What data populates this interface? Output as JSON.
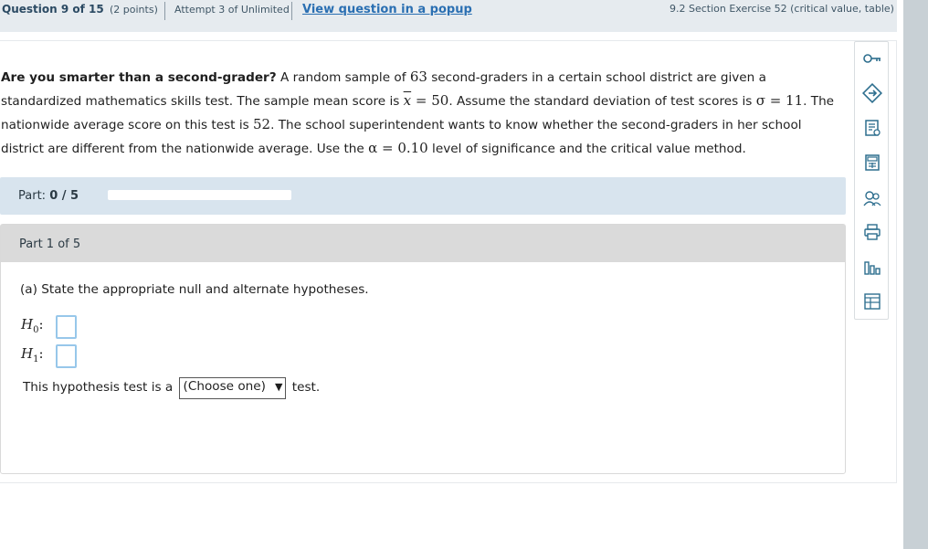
{
  "header": {
    "question_num": "Question 9 of 15",
    "points": "(2 points)",
    "attempt": "Attempt 3 of Unlimited",
    "popup_link": "View question in a popup",
    "section": "9.2 Section Exercise 52 (critical value, table)"
  },
  "question": {
    "lead_bold": "Are you smarter than a second-grader?",
    "t1": " A random sample of ",
    "n": "63",
    "t2": " second-graders in a certain school district are given a standardized mathematics skills test. The sample mean score is ",
    "xbar_sym": "x",
    "eq1": " = 50",
    "t3": ". Assume the standard deviation of test scores is ",
    "sigma": "σ = 11",
    "t4": ". The nationwide average score on this test is ",
    "mu": "52",
    "t5": ". The school superintendent wants to know whether the second-graders in her school district are different from the nationwide average. Use the ",
    "alpha": "α = 0.10",
    "t6": " level of significance and the critical value method."
  },
  "part_progress": {
    "label": "Part:",
    "value": "0 / 5",
    "progress_fraction": 0
  },
  "part": {
    "header": "Part 1 of 5",
    "prompt": "(a) State the appropriate null and alternate hypotheses.",
    "h0_label": "H",
    "h0_sub": "0",
    "h1_label": "H",
    "h1_sub": "1",
    "colon": ":",
    "h0_value": "",
    "h1_value": "",
    "tail_before": "This hypothesis test is a",
    "select_value": "(Choose one)",
    "select_arrow": "▼",
    "tail_after": "test."
  },
  "tools": [
    "key-icon",
    "arrow-diamond-icon",
    "checklist-icon",
    "calculator-icon",
    "people-help-icon",
    "printer-icon",
    "bar-chart-icon",
    "table-icon"
  ],
  "colors": {
    "topbar": "#e6ebef",
    "link": "#2a6fb2",
    "partbar": "#d8e4ee",
    "parthead": "#dadada",
    "answer_border": "#97c7ea",
    "scrollbar": "#c8d0d5"
  }
}
